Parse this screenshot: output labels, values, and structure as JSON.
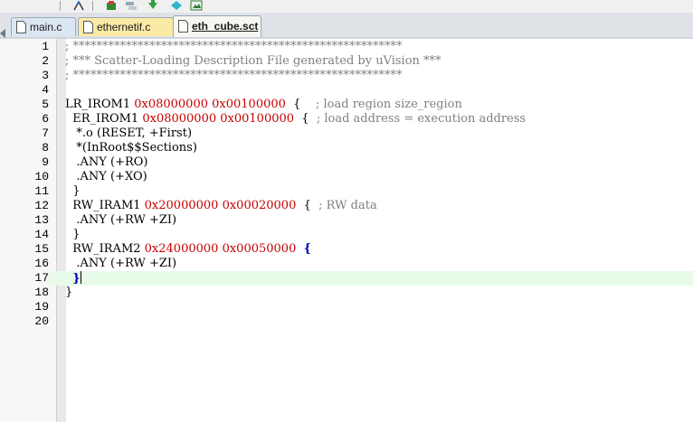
{
  "tabs": [
    {
      "label": "main.c"
    },
    {
      "label": "ethernetif.c"
    },
    {
      "label": "eth_cube.sct"
    }
  ],
  "editor": {
    "lines": [
      {
        "n": "1",
        "parts": [
          {
            "t": "; ********************************************************",
            "c": "comment"
          }
        ]
      },
      {
        "n": "2",
        "parts": [
          {
            "t": "; *** Scatter-Loading Description File generated by uVision ***",
            "c": "comment"
          }
        ]
      },
      {
        "n": "3",
        "parts": [
          {
            "t": "; ********************************************************",
            "c": "comment"
          }
        ]
      },
      {
        "n": "4",
        "parts": []
      },
      {
        "n": "5",
        "parts": [
          {
            "t": "LR_IROM1 ",
            "c": ""
          },
          {
            "t": "0x08000000",
            "c": "hex"
          },
          {
            "t": " ",
            "c": ""
          },
          {
            "t": "0x00100000",
            "c": "hex"
          },
          {
            "t": "  {    ",
            "c": ""
          },
          {
            "t": "; load region size_region",
            "c": "comment"
          }
        ]
      },
      {
        "n": "6",
        "parts": [
          {
            "t": "  ER_IROM1 ",
            "c": ""
          },
          {
            "t": "0x08000000",
            "c": "hex"
          },
          {
            "t": " ",
            "c": ""
          },
          {
            "t": "0x00100000",
            "c": "hex"
          },
          {
            "t": "  {  ",
            "c": ""
          },
          {
            "t": "; load address = execution address",
            "c": "comment"
          }
        ]
      },
      {
        "n": "7",
        "parts": [
          {
            "t": "   *.o (RESET, +First)",
            "c": ""
          }
        ]
      },
      {
        "n": "8",
        "parts": [
          {
            "t": "   *(InRoot$$Sections)",
            "c": ""
          }
        ]
      },
      {
        "n": "9",
        "parts": [
          {
            "t": "   .ANY (+RO)",
            "c": ""
          }
        ]
      },
      {
        "n": "10",
        "parts": [
          {
            "t": "   .ANY (+XO)",
            "c": ""
          }
        ]
      },
      {
        "n": "11",
        "parts": [
          {
            "t": "  }",
            "c": ""
          }
        ]
      },
      {
        "n": "12",
        "parts": [
          {
            "t": "  RW_IRAM1 ",
            "c": ""
          },
          {
            "t": "0x20000000",
            "c": "hex"
          },
          {
            "t": " ",
            "c": ""
          },
          {
            "t": "0x00020000",
            "c": "hex"
          },
          {
            "t": "  {  ",
            "c": ""
          },
          {
            "t": "; RW data",
            "c": "comment"
          }
        ]
      },
      {
        "n": "13",
        "parts": [
          {
            "t": "   .ANY (+RW +ZI)",
            "c": ""
          }
        ]
      },
      {
        "n": "14",
        "parts": [
          {
            "t": "  }",
            "c": ""
          }
        ]
      },
      {
        "n": "15",
        "parts": [
          {
            "t": "  RW_IRAM2 ",
            "c": ""
          },
          {
            "t": "0x24000000",
            "c": "hex"
          },
          {
            "t": " ",
            "c": ""
          },
          {
            "t": "0x00050000",
            "c": "hex"
          },
          {
            "t": "  ",
            "c": ""
          },
          {
            "t": "{",
            "c": "brace-blue"
          }
        ]
      },
      {
        "n": "16",
        "parts": [
          {
            "t": "   .ANY (+RW +ZI)",
            "c": ""
          }
        ]
      },
      {
        "n": "17",
        "parts": [
          {
            "t": "  ",
            "c": ""
          },
          {
            "t": "}",
            "c": "brace-blue"
          }
        ],
        "current": true
      },
      {
        "n": "18",
        "parts": [
          {
            "t": "}",
            "c": ""
          }
        ]
      },
      {
        "n": "19",
        "parts": []
      },
      {
        "n": "20",
        "parts": []
      }
    ]
  },
  "colors": {
    "hex": "#c80000",
    "comment": "#808080",
    "current_line": "#e8fbe9",
    "brace_match": "#0000c0"
  }
}
